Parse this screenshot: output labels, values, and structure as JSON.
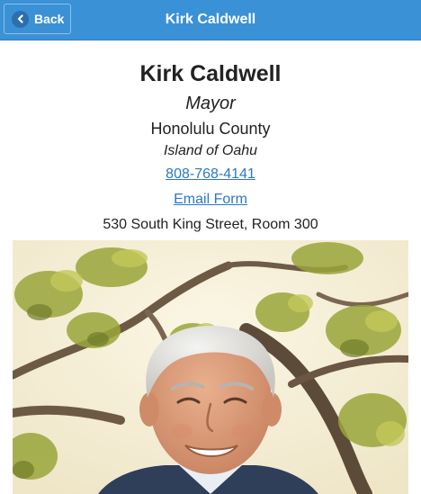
{
  "header": {
    "back_label": "Back",
    "back_icon": "chevron-left-icon",
    "title": "Kirk Caldwell"
  },
  "official": {
    "name": "Kirk Caldwell",
    "role": "Mayor",
    "county": "Honolulu County",
    "island": "Island of Oahu",
    "phone": "808-768-4141",
    "email_label": "Email Form",
    "address": "530 South King Street, Room 300"
  },
  "colors": {
    "header_bg": "#3a91d6",
    "link": "#2a7ac0",
    "text": "#222222"
  }
}
